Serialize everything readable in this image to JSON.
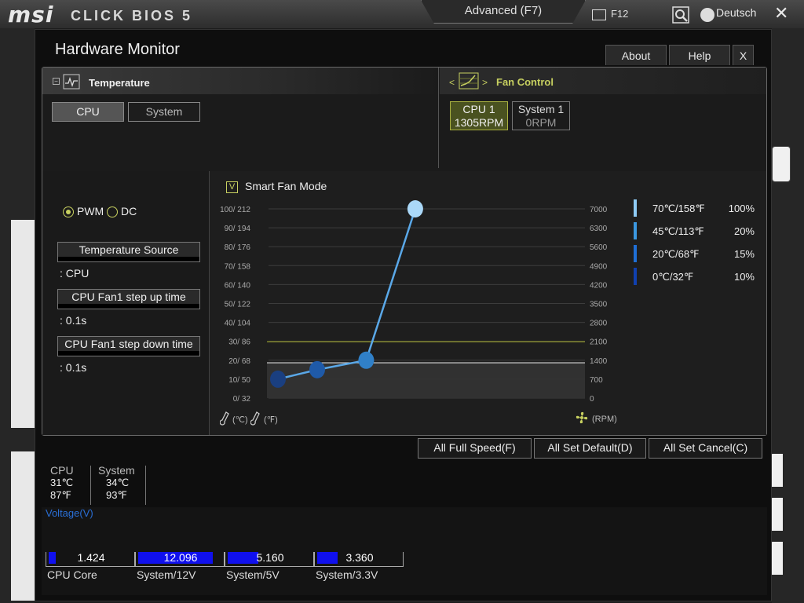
{
  "topbar": {
    "logo": "msi",
    "product": "CLICK BIOS 5",
    "mode": "Advanced (F7)",
    "screenshot_key": "F12",
    "language": "Deutsch",
    "close": "✕"
  },
  "window": {
    "title": "Hardware Monitor",
    "buttons": {
      "about": "About",
      "help": "Help",
      "close": "X"
    }
  },
  "temperature": {
    "label": "Temperature",
    "tabs": [
      "CPU",
      "System"
    ],
    "selected": "CPU"
  },
  "fan_control": {
    "label": "Fan Control",
    "fans": [
      {
        "name": "CPU 1",
        "rpm": "1305RPM",
        "selected": true
      },
      {
        "name": "System 1",
        "rpm": "0RPM",
        "selected": false
      }
    ]
  },
  "settings": {
    "modes": [
      "PWM",
      "DC"
    ],
    "selected_mode": "PWM",
    "temperature_source_label": "Temperature Source",
    "temperature_source_value": ": CPU",
    "step_up_label": "CPU Fan1 step up time",
    "step_up_value": ": 0.1s",
    "step_down_label": "CPU Fan1 step down time",
    "step_down_value": ": 0.1s"
  },
  "smart_fan": {
    "checked": true,
    "check_mark": "V",
    "label": "Smart Fan Mode",
    "celsius_unit": "(℃)",
    "fahrenheit_unit": "(℉)",
    "rpm_unit": "(RPM)",
    "legend": [
      {
        "temp": "70℃/158℉",
        "percent": "100%",
        "color": "#8ecbf5"
      },
      {
        "temp": "45℃/113℉",
        "percent": "20%",
        "color": "#3b98e0"
      },
      {
        "temp": "20℃/68℉",
        "percent": "15%",
        "color": "#1f6fd6"
      },
      {
        "temp": "0℃/32℉",
        "percent": "10%",
        "color": "#1040b0"
      }
    ]
  },
  "chart_data": {
    "type": "line",
    "title": "",
    "y_left_ticks": [
      "100/ 212",
      "90/ 194",
      "80/ 176",
      "70/ 158",
      "60/ 140",
      "50/ 122",
      "40/ 104",
      "30/  86",
      "20/  68",
      "10/  50",
      "0/  32"
    ],
    "y_right_ticks": [
      "7000",
      "6300",
      "5600",
      "4900",
      "4200",
      "3500",
      "2800",
      "2100",
      "1400",
      "700",
      "0"
    ],
    "ylim_temp_c": [
      0,
      100
    ],
    "ylim_rpm": [
      0,
      7000
    ],
    "series": [
      {
        "points": [
          {
            "temp_c": 0,
            "fan_percent": 10
          },
          {
            "temp_c": 20,
            "fan_percent": 15
          },
          {
            "temp_c": 45,
            "fan_percent": 20
          },
          {
            "temp_c": 70,
            "fan_percent": 100
          }
        ]
      }
    ],
    "current_temp_c": 31,
    "current_rpm": 1305,
    "point_colors": [
      "#1a3f80",
      "#1f5aa8",
      "#3080c8",
      "#aad8f8"
    ]
  },
  "actions": {
    "full_speed": "All Full Speed(F)",
    "set_default": "All Set Default(D)",
    "set_cancel": "All Set Cancel(C)"
  },
  "readouts": {
    "cpu": {
      "label": "CPU",
      "c": "31℃",
      "f": "87℉"
    },
    "system": {
      "label": "System",
      "c": "34℃",
      "f": "93℉"
    }
  },
  "voltage": {
    "title": "Voltage(V)",
    "items": [
      {
        "name": "CPU Core",
        "value": "1.424",
        "fill": 0.08
      },
      {
        "name": "System/12V",
        "value": "12.096",
        "fill": 0.88
      },
      {
        "name": "System/5V",
        "value": "5.160",
        "fill": 0.36
      },
      {
        "name": "System/3.3V",
        "value": "3.360",
        "fill": 0.24
      }
    ]
  }
}
